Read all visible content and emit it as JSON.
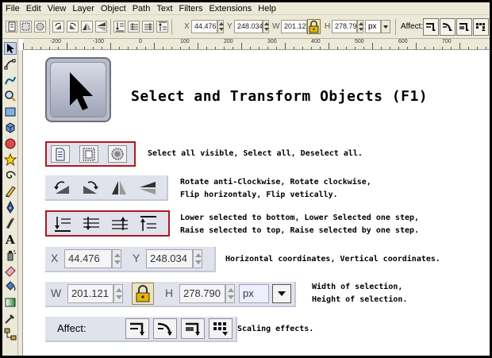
{
  "menu": [
    "File",
    "Edit",
    "View",
    "Layer",
    "Object",
    "Path",
    "Text",
    "Filters",
    "Extensions",
    "Help"
  ],
  "controls": {
    "x_label": "X",
    "x_value": "44.476",
    "y_label": "Y",
    "y_value": "248.034",
    "w_label": "W",
    "w_value": "201.121",
    "h_label": "H",
    "h_value": "278.790",
    "unit": "px",
    "affect_label": "Affect:"
  },
  "ruler": [
    "-200",
    "-100",
    "0",
    "100",
    "200",
    "300",
    "400",
    "500",
    "600",
    "700"
  ],
  "tools": [
    "selector-tool",
    "node-tool",
    "tweak-tool",
    "zoom-tool",
    "rectangle-tool",
    "box-3d-tool",
    "ellipse-tool",
    "star-tool",
    "spiral-tool",
    "pencil-tool",
    "pen-tool",
    "calligraphy-tool",
    "text-tool",
    "spray-tool",
    "eraser-tool",
    "bucket-tool",
    "gradient-tool",
    "dropper-tool",
    "connector-tool"
  ],
  "canvas": {
    "title": "Select and Transform Objects (F1)",
    "descriptions": {
      "select": "Select all visible, Select all, Deselect all.",
      "rotate_1": "Rotate anti-Clockwise, Rotate clockwise,",
      "rotate_2": "Flip horizontaly, Flip vetically.",
      "zorder_1": "Lower selected to bottom, Lower Selected one step,",
      "zorder_2": "Raise selected to top, Raise selected by one step.",
      "coords": "Horizontal coordinates, Vertical coordinates.",
      "size_1": "Width of selection,",
      "size_2": "Height of selection.",
      "affect": "Scaling effects."
    },
    "coord_group": {
      "x_label": "X",
      "x_value": "44.476",
      "y_label": "Y",
      "y_value": "248.034"
    },
    "size_group": {
      "w_label": "W",
      "w_value": "201.121",
      "h_label": "H",
      "h_value": "278.790",
      "unit": "px"
    },
    "affect_group": {
      "label": "Affect:"
    }
  },
  "colors": {
    "highlight_border": "#b01820",
    "panel": "#e0e2ec",
    "chrome": "#ece9d8"
  }
}
